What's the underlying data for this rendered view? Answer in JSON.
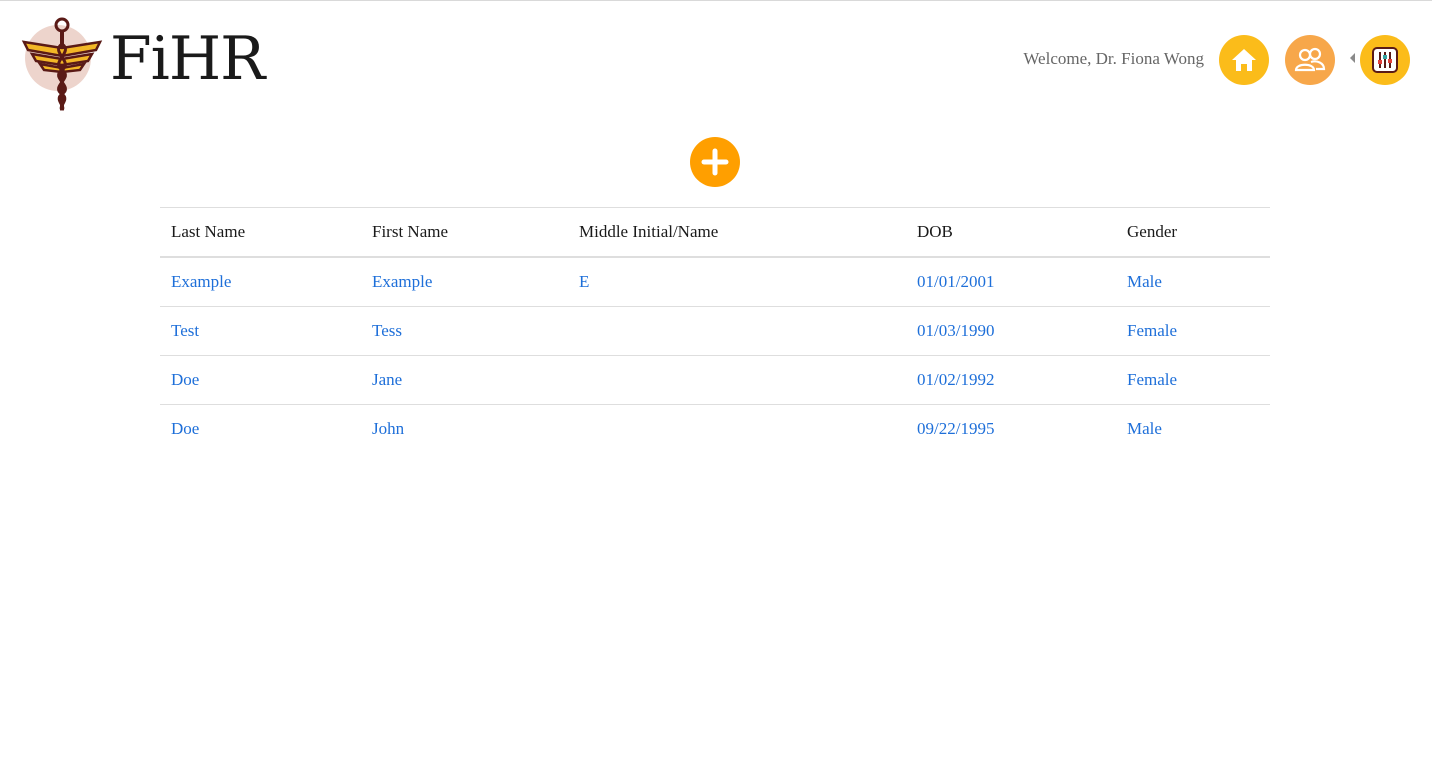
{
  "app": {
    "logo_text": "FiHR"
  },
  "header": {
    "welcome_text": "Welcome, Dr. Fiona Wong",
    "nav": [
      {
        "icon": "home-icon"
      },
      {
        "icon": "people-icon"
      },
      {
        "icon": "settings-sliders-icon"
      }
    ]
  },
  "colors": {
    "accent_yellow": "#fbbc1a",
    "accent_orange": "#ff9f00",
    "link_blue": "#1e6fd9"
  },
  "add_button": {
    "icon": "plus-icon"
  },
  "table": {
    "headers": [
      "Last Name",
      "First Name",
      "Middle Initial/Name",
      "DOB",
      "Gender"
    ],
    "rows": [
      [
        "Example",
        "Example",
        "E",
        "01/01/2001",
        "Male"
      ],
      [
        "Test",
        "Tess",
        "",
        "01/03/1990",
        "Female"
      ],
      [
        "Doe",
        "Jane",
        "",
        "01/02/1992",
        "Female"
      ],
      [
        "Doe",
        "John",
        "",
        "09/22/1995",
        "Male"
      ]
    ]
  }
}
